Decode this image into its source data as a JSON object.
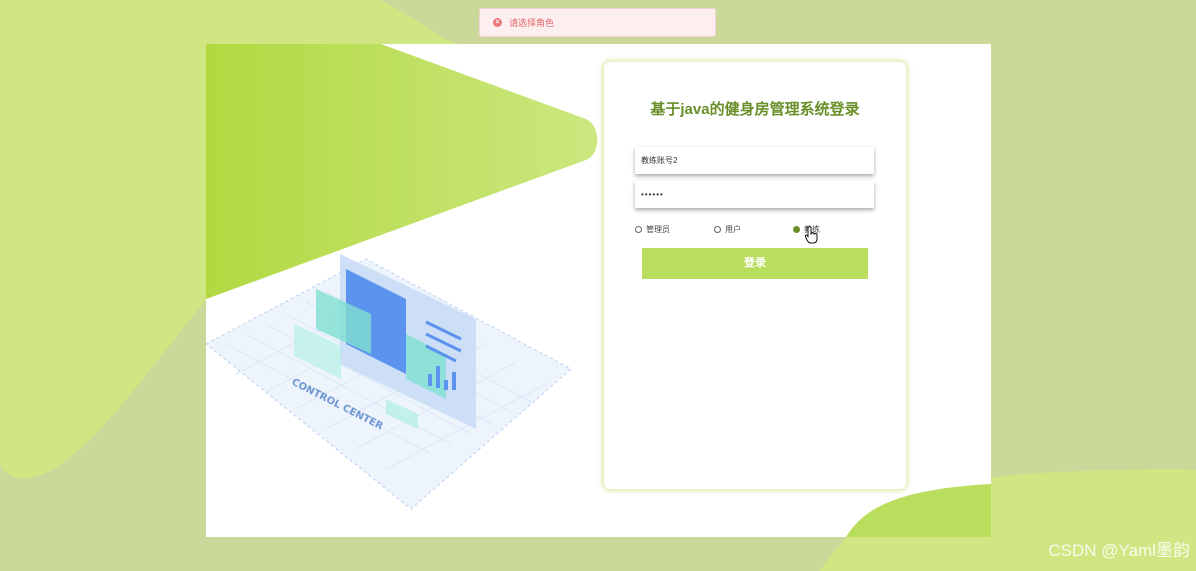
{
  "toast": {
    "icon": "error-icon",
    "message": "请选择角色"
  },
  "login": {
    "title": "基于java的健身房管理系统登录",
    "username_value": "教练账号2",
    "password_value": "••••••",
    "roles": [
      {
        "label": "管理员",
        "selected": false
      },
      {
        "label": "用户",
        "selected": false
      },
      {
        "label": "教练",
        "selected": true
      }
    ],
    "submit_label": "登录"
  },
  "illustration": {
    "caption": "CONTROL CENTER"
  },
  "watermark": "CSDN @Yaml墨韵",
  "colors": {
    "accent": "#b9dd5d",
    "title": "#6a8f2a",
    "background": "#cad99a",
    "error": "#e06769"
  }
}
